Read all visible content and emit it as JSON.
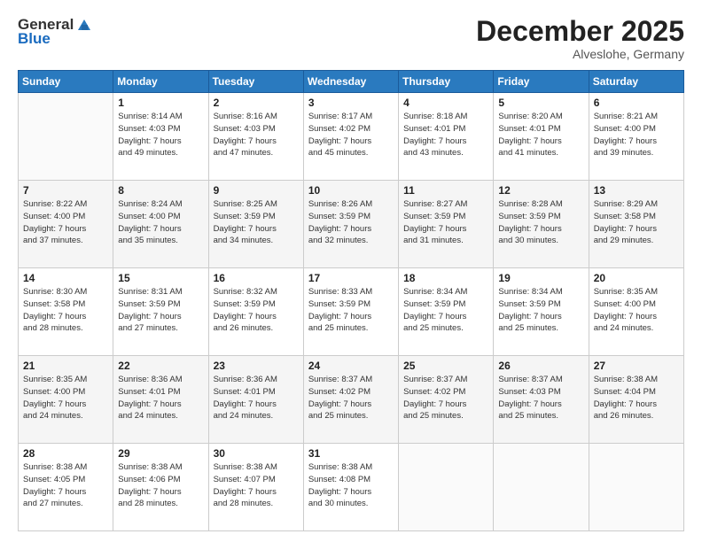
{
  "logo": {
    "general": "General",
    "blue": "Blue"
  },
  "header": {
    "month": "December 2025",
    "location": "Alveslohe, Germany"
  },
  "weekdays": [
    "Sunday",
    "Monday",
    "Tuesday",
    "Wednesday",
    "Thursday",
    "Friday",
    "Saturday"
  ],
  "weeks": [
    [
      {
        "day": "",
        "info": ""
      },
      {
        "day": "1",
        "info": "Sunrise: 8:14 AM\nSunset: 4:03 PM\nDaylight: 7 hours\nand 49 minutes."
      },
      {
        "day": "2",
        "info": "Sunrise: 8:16 AM\nSunset: 4:03 PM\nDaylight: 7 hours\nand 47 minutes."
      },
      {
        "day": "3",
        "info": "Sunrise: 8:17 AM\nSunset: 4:02 PM\nDaylight: 7 hours\nand 45 minutes."
      },
      {
        "day": "4",
        "info": "Sunrise: 8:18 AM\nSunset: 4:01 PM\nDaylight: 7 hours\nand 43 minutes."
      },
      {
        "day": "5",
        "info": "Sunrise: 8:20 AM\nSunset: 4:01 PM\nDaylight: 7 hours\nand 41 minutes."
      },
      {
        "day": "6",
        "info": "Sunrise: 8:21 AM\nSunset: 4:00 PM\nDaylight: 7 hours\nand 39 minutes."
      }
    ],
    [
      {
        "day": "7",
        "info": "Sunrise: 8:22 AM\nSunset: 4:00 PM\nDaylight: 7 hours\nand 37 minutes."
      },
      {
        "day": "8",
        "info": "Sunrise: 8:24 AM\nSunset: 4:00 PM\nDaylight: 7 hours\nand 35 minutes."
      },
      {
        "day": "9",
        "info": "Sunrise: 8:25 AM\nSunset: 3:59 PM\nDaylight: 7 hours\nand 34 minutes."
      },
      {
        "day": "10",
        "info": "Sunrise: 8:26 AM\nSunset: 3:59 PM\nDaylight: 7 hours\nand 32 minutes."
      },
      {
        "day": "11",
        "info": "Sunrise: 8:27 AM\nSunset: 3:59 PM\nDaylight: 7 hours\nand 31 minutes."
      },
      {
        "day": "12",
        "info": "Sunrise: 8:28 AM\nSunset: 3:59 PM\nDaylight: 7 hours\nand 30 minutes."
      },
      {
        "day": "13",
        "info": "Sunrise: 8:29 AM\nSunset: 3:58 PM\nDaylight: 7 hours\nand 29 minutes."
      }
    ],
    [
      {
        "day": "14",
        "info": "Sunrise: 8:30 AM\nSunset: 3:58 PM\nDaylight: 7 hours\nand 28 minutes."
      },
      {
        "day": "15",
        "info": "Sunrise: 8:31 AM\nSunset: 3:59 PM\nDaylight: 7 hours\nand 27 minutes."
      },
      {
        "day": "16",
        "info": "Sunrise: 8:32 AM\nSunset: 3:59 PM\nDaylight: 7 hours\nand 26 minutes."
      },
      {
        "day": "17",
        "info": "Sunrise: 8:33 AM\nSunset: 3:59 PM\nDaylight: 7 hours\nand 25 minutes."
      },
      {
        "day": "18",
        "info": "Sunrise: 8:34 AM\nSunset: 3:59 PM\nDaylight: 7 hours\nand 25 minutes."
      },
      {
        "day": "19",
        "info": "Sunrise: 8:34 AM\nSunset: 3:59 PM\nDaylight: 7 hours\nand 25 minutes."
      },
      {
        "day": "20",
        "info": "Sunrise: 8:35 AM\nSunset: 4:00 PM\nDaylight: 7 hours\nand 24 minutes."
      }
    ],
    [
      {
        "day": "21",
        "info": "Sunrise: 8:35 AM\nSunset: 4:00 PM\nDaylight: 7 hours\nand 24 minutes."
      },
      {
        "day": "22",
        "info": "Sunrise: 8:36 AM\nSunset: 4:01 PM\nDaylight: 7 hours\nand 24 minutes."
      },
      {
        "day": "23",
        "info": "Sunrise: 8:36 AM\nSunset: 4:01 PM\nDaylight: 7 hours\nand 24 minutes."
      },
      {
        "day": "24",
        "info": "Sunrise: 8:37 AM\nSunset: 4:02 PM\nDaylight: 7 hours\nand 25 minutes."
      },
      {
        "day": "25",
        "info": "Sunrise: 8:37 AM\nSunset: 4:02 PM\nDaylight: 7 hours\nand 25 minutes."
      },
      {
        "day": "26",
        "info": "Sunrise: 8:37 AM\nSunset: 4:03 PM\nDaylight: 7 hours\nand 25 minutes."
      },
      {
        "day": "27",
        "info": "Sunrise: 8:38 AM\nSunset: 4:04 PM\nDaylight: 7 hours\nand 26 minutes."
      }
    ],
    [
      {
        "day": "28",
        "info": "Sunrise: 8:38 AM\nSunset: 4:05 PM\nDaylight: 7 hours\nand 27 minutes."
      },
      {
        "day": "29",
        "info": "Sunrise: 8:38 AM\nSunset: 4:06 PM\nDaylight: 7 hours\nand 28 minutes."
      },
      {
        "day": "30",
        "info": "Sunrise: 8:38 AM\nSunset: 4:07 PM\nDaylight: 7 hours\nand 28 minutes."
      },
      {
        "day": "31",
        "info": "Sunrise: 8:38 AM\nSunset: 4:08 PM\nDaylight: 7 hours\nand 30 minutes."
      },
      {
        "day": "",
        "info": ""
      },
      {
        "day": "",
        "info": ""
      },
      {
        "day": "",
        "info": ""
      }
    ]
  ]
}
